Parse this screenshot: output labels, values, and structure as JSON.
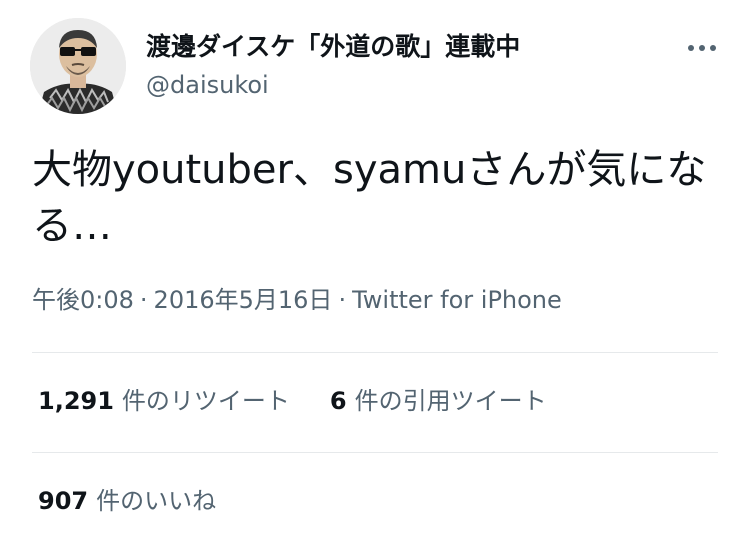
{
  "author": {
    "display_name": "渡邊ダイスケ「外道の歌」連載中",
    "handle": "@daisukoi",
    "avatar": "avatar-illustration"
  },
  "more_icon": "more-horizontal-icon",
  "tweet": {
    "text": "大物youtuber、syamuさんが気になる…"
  },
  "meta": {
    "time": "午後0:08",
    "separator": "·",
    "date": "2016年5月16日",
    "source": "Twitter for iPhone"
  },
  "stats": {
    "retweets": {
      "count": "1,291",
      "label": "件のリツイート"
    },
    "quotes": {
      "count": "6",
      "label": "件の引用ツイート"
    },
    "likes": {
      "count": "907",
      "label": "件のいいね"
    }
  },
  "colors": {
    "text_primary": "#0f1419",
    "text_secondary": "#536471",
    "divider": "#e6e9eb"
  }
}
